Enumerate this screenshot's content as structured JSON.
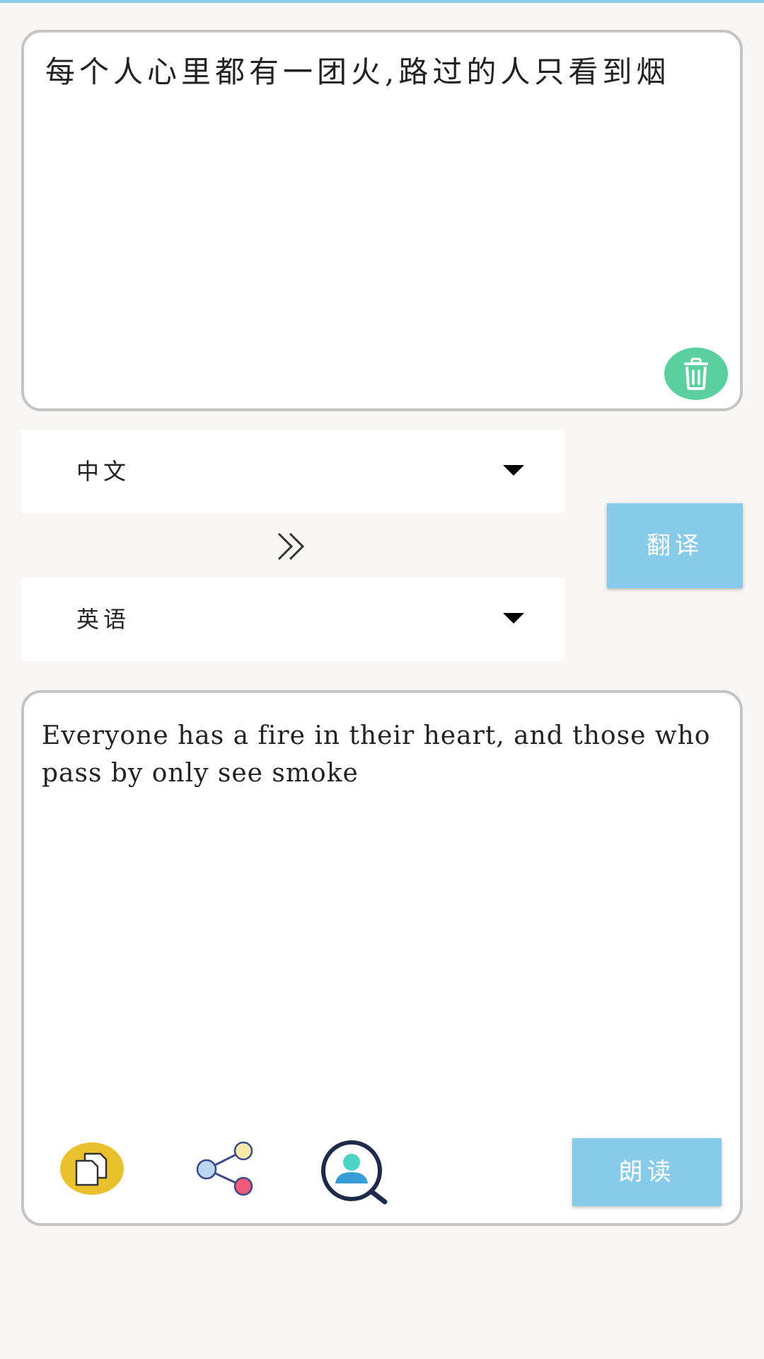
{
  "source": {
    "text": "每个人心里都有一团火,路过的人只看到烟"
  },
  "languages": {
    "from": "中文",
    "to": "英语"
  },
  "translate_label": "翻译",
  "result": {
    "text": "Everyone has a fire in their heart, and those who pass by only see smoke"
  },
  "read_label": "朗读",
  "colors": {
    "accent_blue": "#86cbea",
    "clear_green": "#5ad0a0",
    "copy_yellow": "#e8c12c"
  },
  "icons": [
    "trash-icon",
    "chevron-double-right-icon",
    "copy-icon",
    "share-icon",
    "user-search-icon",
    "dropdown-caret-icon"
  ]
}
